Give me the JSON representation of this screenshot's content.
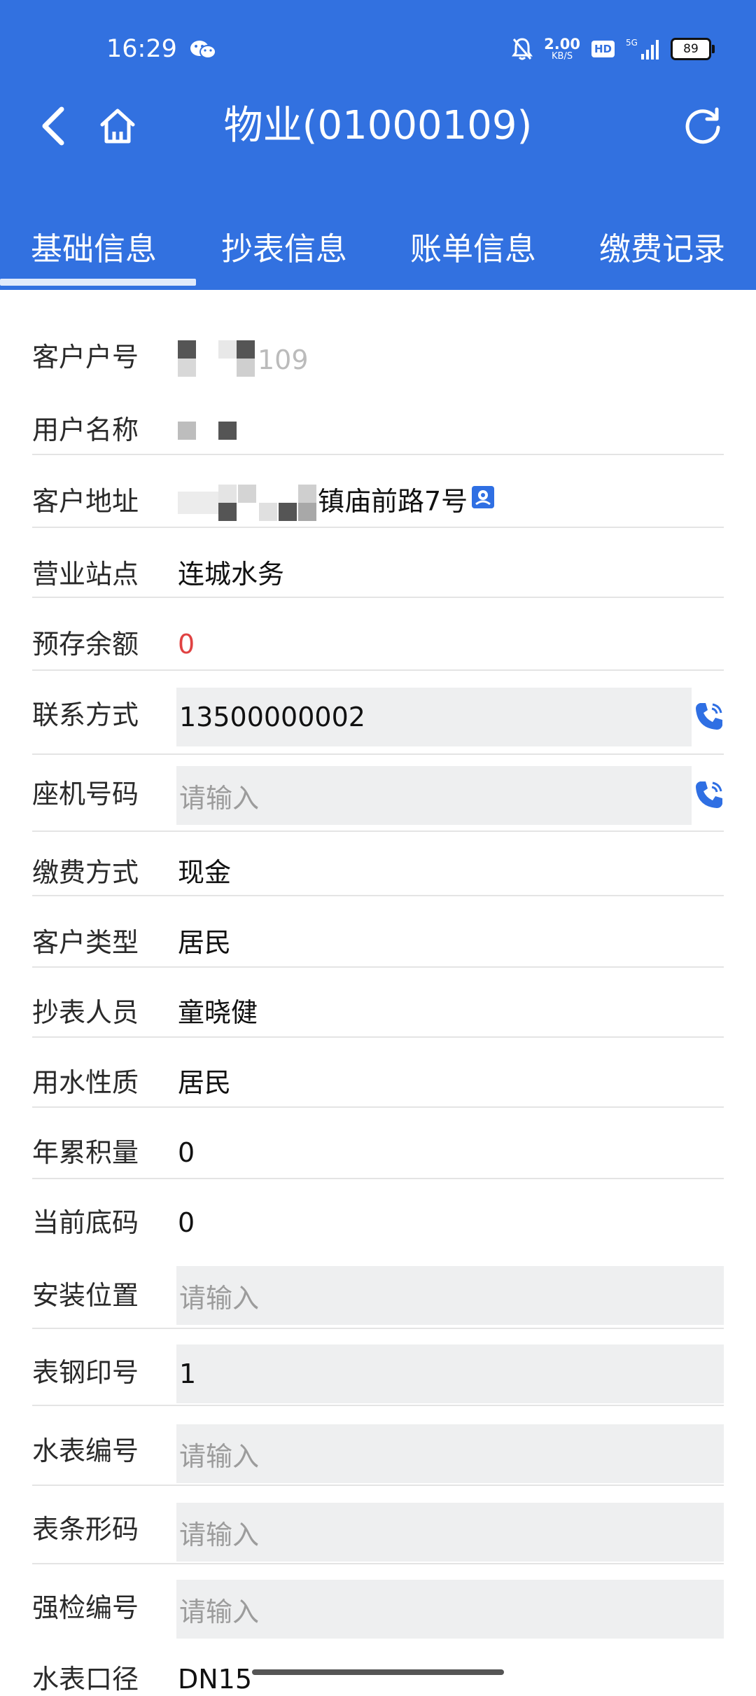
{
  "status_bar": {
    "time": "16:29",
    "net_speed_value": "2.00",
    "net_speed_unit": "KB/S",
    "hd_label": "HD",
    "network": "5G",
    "battery": "89"
  },
  "nav": {
    "title": "物业(01000109)",
    "icons": [
      "chevron-left-icon",
      "home-icon",
      "refresh-icon"
    ]
  },
  "tabs": [
    {
      "label": "基础信息",
      "active": true
    },
    {
      "label": "抄表信息",
      "active": false
    },
    {
      "label": "账单信息",
      "active": false
    },
    {
      "label": "缴费记录",
      "active": false
    }
  ],
  "fields": {
    "customer_no": {
      "label": "客户户号",
      "value": "109"
    },
    "user_name": {
      "label": "用户名称",
      "value": ""
    },
    "address": {
      "label": "客户地址",
      "value": "镇庙前路7号"
    },
    "station": {
      "label": "营业站点",
      "value": "连城水务"
    },
    "balance": {
      "label": "预存余额",
      "value": "0"
    },
    "contact": {
      "label": "联系方式",
      "value": "13500000002"
    },
    "landline": {
      "label": "座机号码",
      "placeholder": "请输入"
    },
    "pay_method": {
      "label": "缴费方式",
      "value": "现金"
    },
    "customer_type": {
      "label": "客户类型",
      "value": "居民"
    },
    "reader": {
      "label": "抄表人员",
      "value": "童晓健"
    },
    "water_nature": {
      "label": "用水性质",
      "value": "居民"
    },
    "annual_total": {
      "label": "年累积量",
      "value": "0"
    },
    "current_reading": {
      "label": "当前底码",
      "value": "0"
    },
    "install_location": {
      "label": "安装位置",
      "placeholder": "请输入"
    },
    "seal_no": {
      "label": "表钢印号",
      "value": "1"
    },
    "meter_no": {
      "label": "水表编号",
      "placeholder": "请输入"
    },
    "barcode": {
      "label": "表条形码",
      "placeholder": "请输入"
    },
    "inspection_no": {
      "label": "强检编号",
      "placeholder": "请输入"
    },
    "caliber": {
      "label": "水表口径",
      "value": "DN15"
    }
  },
  "colors": {
    "header": "#3271e0",
    "accent": "#2f6fe3",
    "balance_red": "#e04242",
    "input_bg": "#eeeff0"
  }
}
